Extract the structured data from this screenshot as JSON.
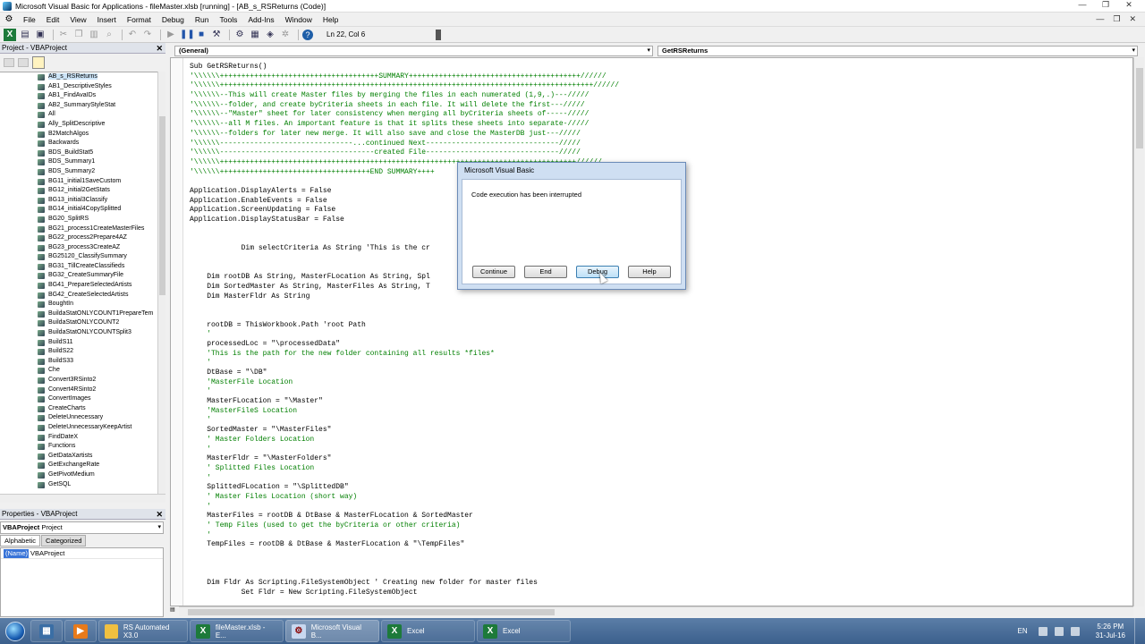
{
  "window": {
    "title": "Microsoft Visual Basic for Applications - fileMaster.xlsb [running] - [AB_s_RSReturns (Code)]",
    "controls": [
      "—",
      "❐",
      "✕"
    ],
    "mdi_controls": [
      "—",
      "❐",
      "✕"
    ]
  },
  "menu": {
    "items": [
      "File",
      "Edit",
      "View",
      "Insert",
      "Format",
      "Debug",
      "Run",
      "Tools",
      "Add-Ins",
      "Window",
      "Help"
    ]
  },
  "toolbar": {
    "position": "Ln 22, Col 6"
  },
  "project": {
    "title": "Project - VBAProject",
    "modules": [
      "AB_s_RSReturns",
      "AB1_DescriptiveStyles",
      "AB1_FindAvaIDs",
      "AB2_SummaryStyleStat",
      "All",
      "Ally_SplitDescriptive",
      "B2MatchAlgos",
      "Backwards",
      "BDS_BuildStat5",
      "BDS_Summary1",
      "BDS_Summary2",
      "BG11_initial1SaveCustom",
      "BG12_initial2GetStats",
      "BG13_initial3Classify",
      "BG14_initial4CopySplitted",
      "BG20_SplitRS",
      "BG21_process1CreateMasterFiles",
      "BG22_process2Prepare4AZ",
      "BG23_process3CreateAZ",
      "BG25120_ClassifySummary",
      "BG31_TillCreateClassifieds",
      "BG32_CreateSummaryFile",
      "BG41_PrepareSelectedArtists",
      "BG42_CreateSelectedArtists",
      "BoughtIn",
      "BuildaStatONLYCOUNT1PrepareTem",
      "BuildaStatONLYCOUNT2",
      "BuildaStatONLYCOUNTSplit3",
      "BuildS11",
      "BuildS22",
      "BuildS33",
      "Che",
      "Convert3RSinto2",
      "Convert4RSinto2",
      "ConvertImages",
      "CreateCharts",
      "DeleteUnnecessary",
      "DeleteUnnecessaryKeepArtist",
      "FindDateX",
      "Functions",
      "GetDataXartists",
      "GetExchangeRate",
      "GetPivotMedium",
      "GetSQL"
    ]
  },
  "properties": {
    "title": "Properties - VBAProject",
    "object_name": "VBAProject",
    "object_type": "Project",
    "tabs": [
      "Alphabetic",
      "Categorized"
    ],
    "rows": [
      {
        "key": "(Name)",
        "value": "VBAProject"
      }
    ]
  },
  "code": {
    "object_combo": "(General)",
    "proc_combo": "GetRSReturns",
    "lines": [
      {
        "t": "Sub GetRSReturns()",
        "c": false
      },
      {
        "t": "'\\\\\\\\\\\\+++++++++++++++++++++++++++++++++++++SUMMARY++++++++++++++++++++++++++++++++++++++++//////",
        "c": true
      },
      {
        "t": "'\\\\\\\\\\\\+++++++++++++++++++++++++++++++++++++++++++++++++++++++++++++++++++++++++++++++++++++++//////",
        "c": true
      },
      {
        "t": "'\\\\\\\\\\\\--This will create Master files by merging the files in each numerated (1,9,.)---/////",
        "c": true
      },
      {
        "t": "'\\\\\\\\\\\\--folder, and create byCriteria sheets in each file. It will delete the first---/////",
        "c": true
      },
      {
        "t": "'\\\\\\\\\\\\--\"Master\" sheet for later consistency when merging all byCriteria sheets of-----/////",
        "c": true
      },
      {
        "t": "'\\\\\\\\\\\\--all M files. An important feature is that it splits these sheets into separate-/////",
        "c": true
      },
      {
        "t": "'\\\\\\\\\\\\--folders for later new merge. It will also save and close the MasterDB just---/////",
        "c": true
      },
      {
        "t": "'\\\\\\\\\\\\-------------------------------...continued Next-------------------------------/////",
        "c": true
      },
      {
        "t": "'\\\\\\\\\\\\------------------------------------created File-------------------------------/////",
        "c": true
      },
      {
        "t": "'\\\\\\\\\\\\+++++++++++++++++++++++++++++++++++++++++++++++++++++++++++++++++++++++++++++++++++//////",
        "c": true
      },
      {
        "t": "'\\\\\\\\\\\\+++++++++++++++++++++++++++++++++++END SUMMARY++++",
        "c": true
      },
      {
        "t": "",
        "c": false
      },
      {
        "t": "Application.DisplayAlerts = False",
        "c": false
      },
      {
        "t": "Application.EnableEvents = False",
        "c": false
      },
      {
        "t": "Application.ScreenUpdating = False",
        "c": false
      },
      {
        "t": "Application.DisplayStatusBar = False",
        "c": false
      },
      {
        "t": "",
        "c": false
      },
      {
        "t": "",
        "c": false
      },
      {
        "t": "            Dim selectCriteria As String 'This is the cr",
        "c": false
      },
      {
        "t": "",
        "c": false
      },
      {
        "t": "",
        "c": false
      },
      {
        "t": "    Dim rootDB As String, MasterFLocation As String, Spl",
        "c": false
      },
      {
        "t": "    Dim SortedMaster As String, MasterFiles As String, T",
        "c": false
      },
      {
        "t": "    Dim MasterFldr As String",
        "c": false
      },
      {
        "t": "",
        "c": false
      },
      {
        "t": "",
        "c": false
      },
      {
        "t": "    rootDB = ThisWorkbook.Path 'root Path",
        "c": false
      },
      {
        "t": "    '",
        "c": true
      },
      {
        "t": "    processedLoc = \"\\processedData\"",
        "c": false
      },
      {
        "t": "    'This is the path for the new folder containing all results *files*",
        "c": true
      },
      {
        "t": "    '",
        "c": true
      },
      {
        "t": "    DtBase = \"\\DB\"",
        "c": false
      },
      {
        "t": "    'MasterFile Location",
        "c": true
      },
      {
        "t": "    '",
        "c": true
      },
      {
        "t": "    MasterFLocation = \"\\Master\"",
        "c": false
      },
      {
        "t": "    'MasterFileS Location",
        "c": true
      },
      {
        "t": "    '",
        "c": true
      },
      {
        "t": "    SortedMaster = \"\\MasterFiles\"",
        "c": false
      },
      {
        "t": "    ' Master Folders Location",
        "c": true
      },
      {
        "t": "    '",
        "c": true
      },
      {
        "t": "    MasterFldr = \"\\MasterFolders\"",
        "c": false
      },
      {
        "t": "    ' Splitted Files Location",
        "c": true
      },
      {
        "t": "    '",
        "c": true
      },
      {
        "t": "    SplittedFLocation = \"\\SplittedDB\"",
        "c": false
      },
      {
        "t": "    ' Master Files Location (short way)",
        "c": true
      },
      {
        "t": "    '",
        "c": true
      },
      {
        "t": "    MasterFiles = rootDB & DtBase & MasterFLocation & SortedMaster",
        "c": false
      },
      {
        "t": "    ' Temp Files (used to get the byCriteria or other criteria)",
        "c": true
      },
      {
        "t": "    '",
        "c": true
      },
      {
        "t": "    TempFiles = rootDB & DtBase & MasterFLocation & \"\\TempFiles\"",
        "c": false
      },
      {
        "t": "",
        "c": false
      },
      {
        "t": "",
        "c": false
      },
      {
        "t": "",
        "c": false
      },
      {
        "t": "    Dim Fldr As Scripting.FileSystemObject ' Creating new folder for master files",
        "c": false
      },
      {
        "t": "            Set Fldr = New Scripting.FileSystemObject",
        "c": false
      }
    ]
  },
  "dialog": {
    "title": "Microsoft Visual Basic",
    "message": "Code execution has been interrupted",
    "buttons": {
      "continue": "Continue",
      "end": "End",
      "debug": "Debug",
      "help": "Help"
    }
  },
  "taskbar": {
    "apps": [
      {
        "label": "RS Automated X3.0",
        "icon": "folder-icon"
      },
      {
        "label": "fileMaster.xlsb - E...",
        "icon": "excel-icon"
      },
      {
        "label": "Microsoft Visual B...",
        "icon": "vba-icon"
      },
      {
        "label": "Excel",
        "icon": "excel-icon"
      },
      {
        "label": "Excel",
        "icon": "excel-icon"
      }
    ],
    "language": "EN",
    "time": "5:26 PM",
    "date": "31-Jul-16"
  }
}
